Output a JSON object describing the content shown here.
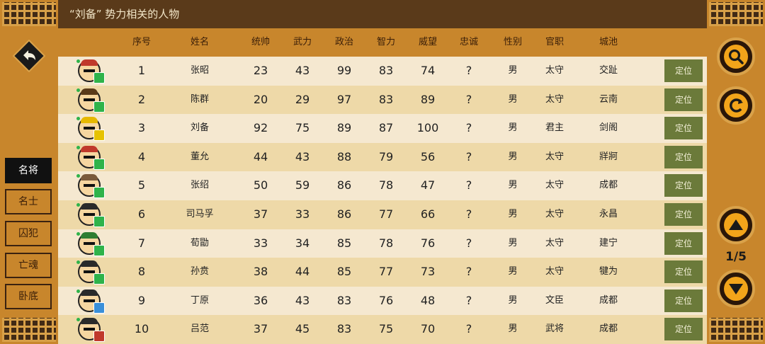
{
  "title": "“刘备” 势力相关的人物",
  "headers": [
    "序号",
    "姓名",
    "统帅",
    "武力",
    "政治",
    "智力",
    "威望",
    "忠诚",
    "性别",
    "官职",
    "城池"
  ],
  "locate_label": "定位",
  "tabs": [
    "名将",
    "名士",
    "囚犯",
    "亡魂",
    "卧底"
  ],
  "active_tab": 0,
  "page_indicator": "1/5",
  "rows": [
    {
      "no": "1",
      "name": "张昭",
      "tong": "23",
      "wu": "43",
      "zheng": "99",
      "zhi": "83",
      "wei": "74",
      "zhong": "?",
      "sex": "男",
      "office": "太守",
      "city": "交趾",
      "hat_color": "#c0392b",
      "badge_color": "#2fb34a"
    },
    {
      "no": "2",
      "name": "陈群",
      "tong": "20",
      "wu": "29",
      "zheng": "97",
      "zhi": "83",
      "wei": "89",
      "zhong": "?",
      "sex": "男",
      "office": "太守",
      "city": "云南",
      "hat_color": "#5a3a1a",
      "badge_color": "#2fb34a"
    },
    {
      "no": "3",
      "name": "刘备",
      "tong": "92",
      "wu": "75",
      "zheng": "89",
      "zhi": "87",
      "wei": "100",
      "zhong": "?",
      "sex": "男",
      "office": "君主",
      "city": "剑阁",
      "hat_color": "#e6b800",
      "badge_color": "#e6c200"
    },
    {
      "no": "4",
      "name": "董允",
      "tong": "44",
      "wu": "43",
      "zheng": "88",
      "zhi": "79",
      "wei": "56",
      "zhong": "?",
      "sex": "男",
      "office": "太守",
      "city": "牂牁",
      "hat_color": "#c0392b",
      "badge_color": "#2fb34a"
    },
    {
      "no": "5",
      "name": "张绍",
      "tong": "50",
      "wu": "59",
      "zheng": "86",
      "zhi": "78",
      "wei": "47",
      "zhong": "?",
      "sex": "男",
      "office": "太守",
      "city": "成都",
      "hat_color": "#7a5a3a",
      "badge_color": "#2fb34a"
    },
    {
      "no": "6",
      "name": "司马孚",
      "tong": "37",
      "wu": "33",
      "zheng": "86",
      "zhi": "77",
      "wei": "66",
      "zhong": "?",
      "sex": "男",
      "office": "太守",
      "city": "永昌",
      "hat_color": "#2a2a2a",
      "badge_color": "#2fb34a"
    },
    {
      "no": "7",
      "name": "荀勖",
      "tong": "33",
      "wu": "34",
      "zheng": "85",
      "zhi": "78",
      "wei": "76",
      "zhong": "?",
      "sex": "男",
      "office": "太守",
      "city": "建宁",
      "hat_color": "#2f7d32",
      "badge_color": "#2fb34a"
    },
    {
      "no": "8",
      "name": "孙贲",
      "tong": "38",
      "wu": "44",
      "zheng": "85",
      "zhi": "77",
      "wei": "73",
      "zhong": "?",
      "sex": "男",
      "office": "太守",
      "city": "犍为",
      "hat_color": "#2a2a2a",
      "badge_color": "#2fb34a"
    },
    {
      "no": "9",
      "name": "丁原",
      "tong": "36",
      "wu": "43",
      "zheng": "83",
      "zhi": "76",
      "wei": "48",
      "zhong": "?",
      "sex": "男",
      "office": "文臣",
      "city": "成都",
      "hat_color": "#2a2a2a",
      "badge_color": "#3a8fd9"
    },
    {
      "no": "10",
      "name": "吕范",
      "tong": "37",
      "wu": "45",
      "zheng": "83",
      "zhi": "75",
      "wei": "70",
      "zhong": "?",
      "sex": "男",
      "office": "武将",
      "city": "成都",
      "hat_color": "#2a2a2a",
      "badge_color": "#c0392b"
    }
  ]
}
